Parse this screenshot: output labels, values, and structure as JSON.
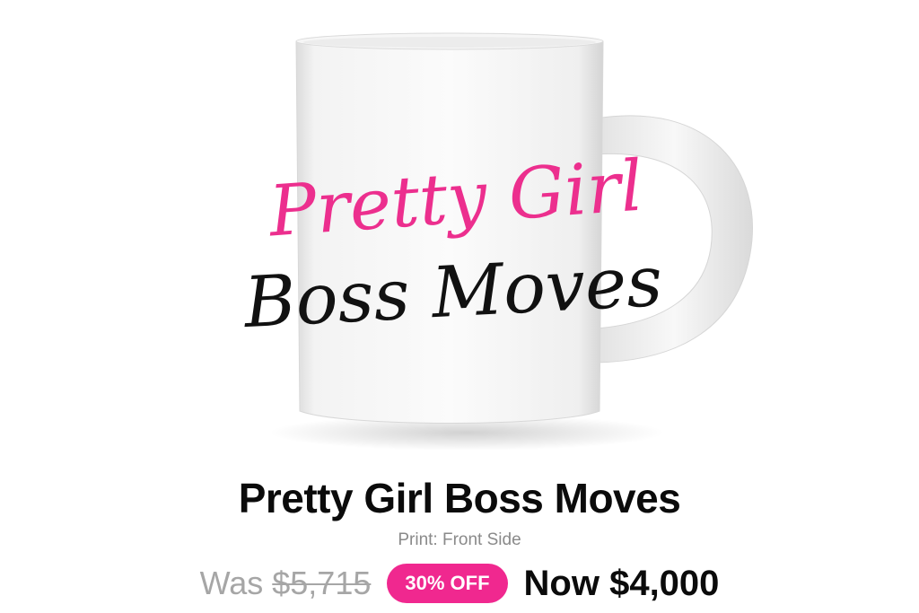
{
  "product": {
    "image": {
      "print_line1": "Pretty Girl",
      "print_line2": "Boss Moves",
      "print_color_1": "#ec2f8e",
      "print_color_2": "#111111"
    },
    "title": "Pretty Girl Boss Moves",
    "variant": "Print: Front Side",
    "price": {
      "was_label": "Was",
      "was_value": "$5,715",
      "discount": "30% OFF",
      "now_label": "Now",
      "now_value": "$4,000"
    }
  },
  "colors": {
    "accent": "#f0288f",
    "text": "#0b0b0b",
    "muted": "#8a8a8a"
  }
}
